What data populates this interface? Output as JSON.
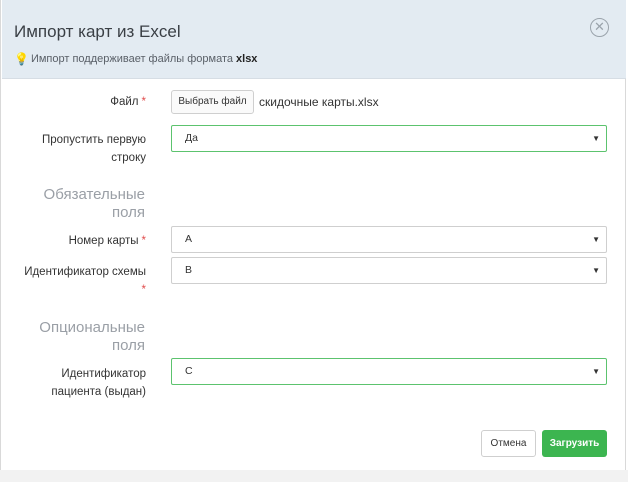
{
  "dialog": {
    "title": "Импорт карт из Excel",
    "close_symbol": "✕",
    "hint_text": "Импорт поддерживает файлы формата",
    "hint_format": "xlsx"
  },
  "form": {
    "file": {
      "label": "Файл",
      "required": "*",
      "button": "Выбрать файл",
      "filename": "скидочные карты.xlsx"
    },
    "skip_first_row": {
      "label_line1": "Пропустить первую",
      "label_line2": "строку",
      "value": "Да"
    },
    "required_section": {
      "line1": "Обязательные",
      "line2": "поля"
    },
    "card_number": {
      "label": "Номер карты",
      "required": "*",
      "value": "A"
    },
    "scheme_id": {
      "label": "Идентификатор схемы",
      "required": "*",
      "value": "B"
    },
    "optional_section": {
      "line1": "Опциональные",
      "line2": "поля"
    },
    "patient_id": {
      "label_line1": "Идентификатор",
      "label_line2": "пациента (выдан)",
      "value": "C"
    }
  },
  "footer": {
    "cancel": "Отмена",
    "upload": "Загрузить"
  },
  "colors": {
    "header_bg": "#e3ebf2",
    "accent_green": "#3cb550",
    "required_red": "#e04c4c"
  },
  "icons": {
    "hint": "lightbulb-icon",
    "close": "close-circle-icon",
    "dropdown": "caret-down-icon"
  }
}
